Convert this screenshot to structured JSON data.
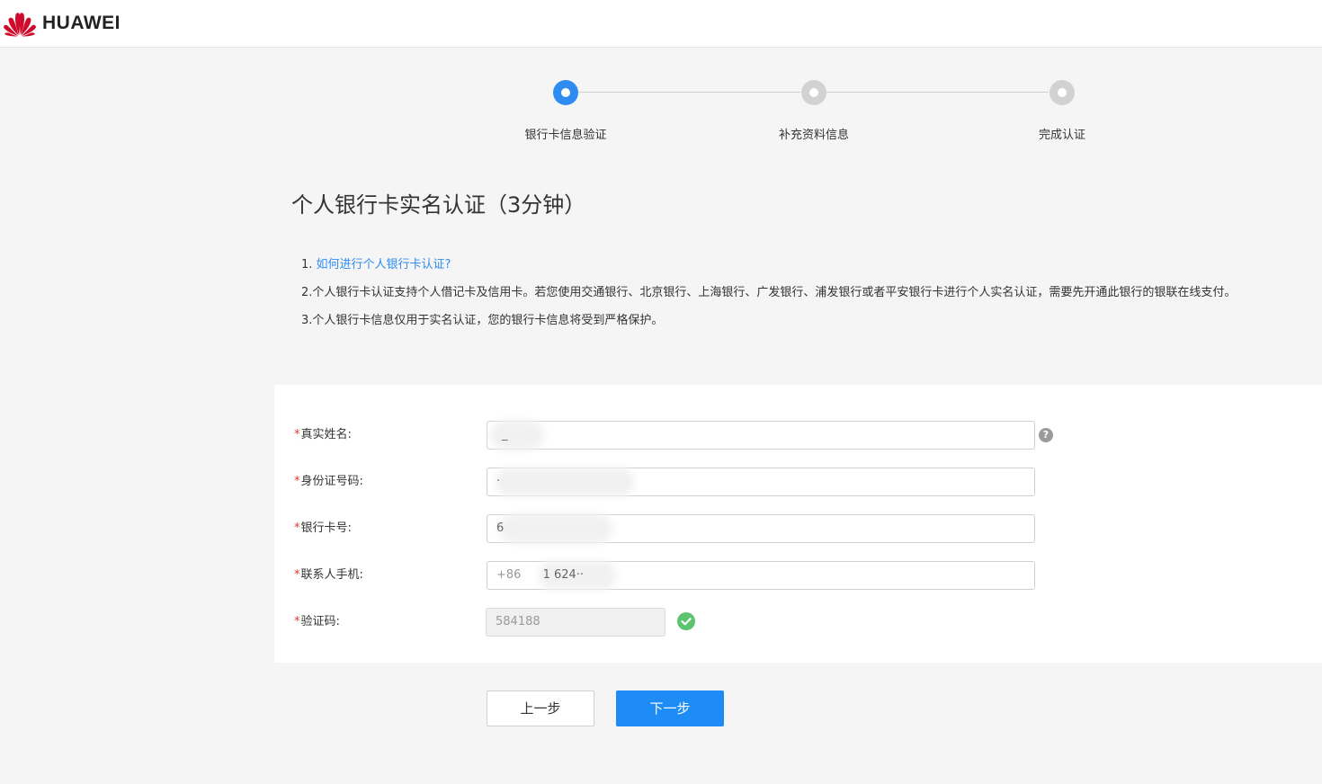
{
  "brand": {
    "name": "HUAWEI",
    "logo_icon": "huawei-petal-logo",
    "color": "#cf0a2c"
  },
  "steps": [
    {
      "label": "银行卡信息验证",
      "state": "active"
    },
    {
      "label": "补充资料信息",
      "state": "pending"
    },
    {
      "label": "完成认证",
      "state": "pending"
    }
  ],
  "page_title": "个人银行卡实名认证（3分钟）",
  "notes": {
    "n1_prefix": "1. ",
    "n1_link": "如何进行个人银行卡认证?",
    "n2": "2.个人银行卡认证支持个人借记卡及信用卡。若您使用交通银行、北京银行、上海银行、广发银行、浦发银行或者平安银行卡进行个人实名认证，需要先开通此银行的银联在线支付。",
    "n3": "3.个人银行卡信息仅用于实名认证，您的银行卡信息将受到严格保护。"
  },
  "form": {
    "required_mark": "*",
    "name": {
      "label": "真实姓名:",
      "value": "_",
      "help_icon": "question-circle-icon"
    },
    "id_number": {
      "label": "身份证号码:",
      "value": "·"
    },
    "card_number": {
      "label": "银行卡号:",
      "value": "6"
    },
    "phone": {
      "label": "联系人手机:",
      "prefix": "+86",
      "value": "1 624··"
    },
    "code": {
      "label": "验证码:",
      "value": "584188",
      "status_icon": "check-circle-icon"
    }
  },
  "buttons": {
    "prev": "上一步",
    "next": "下一步"
  },
  "colors": {
    "accent": "#1e8cf5",
    "step_active": "#2e8cf0",
    "step_inactive": "#d2d2d2",
    "success": "#5cc36e",
    "required": "#e0382d"
  }
}
